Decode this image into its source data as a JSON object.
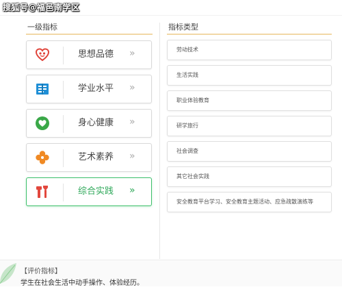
{
  "watermark": "搜狐号@福邑南学区",
  "left_panel": {
    "title": "一级指标",
    "categories": [
      {
        "label": "思想品德",
        "arrow": "»",
        "icon": "heart-icon",
        "active": false
      },
      {
        "label": "学业水平",
        "arrow": "»",
        "icon": "book-icon",
        "active": false
      },
      {
        "label": "身心健康",
        "arrow": "»",
        "icon": "health-icon",
        "active": false
      },
      {
        "label": "艺术素养",
        "arrow": "»",
        "icon": "flower-icon",
        "active": false
      },
      {
        "label": "综合实践",
        "arrow": "»",
        "icon": "tools-icon",
        "active": true
      }
    ]
  },
  "right_panel": {
    "title": "指标类型",
    "types": [
      "劳动技术",
      "生活实践",
      "职业体验教育",
      "研学旅行",
      "社会调查",
      "其它社会实践",
      "安全教育平台学习、安全教育主题活动、应急疏散演练等"
    ]
  },
  "footer": {
    "title": "【评价指标】",
    "text": "学生在社会生活中动手操作、体验经历。"
  },
  "colors": {
    "accent_green": "#2fa85a",
    "divider_orange": "#f2d8a6",
    "heart_red": "#e0443a",
    "book_blue": "#1f8fd6",
    "health_green": "#3aa848",
    "flower_orange": "#f08a24",
    "tools_red": "#e2473d"
  }
}
